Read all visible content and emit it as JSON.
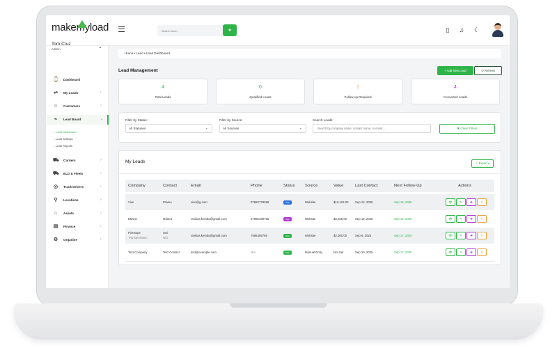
{
  "app": {
    "logo_text": "makemyload",
    "search_placeholder": "Search here...",
    "search_button": "●"
  },
  "user": {
    "name": "Tom Cruz",
    "role": "Admin"
  },
  "sidebar": {
    "items": [
      {
        "label": "Dashboard",
        "icon": "⌚",
        "chev": ""
      },
      {
        "label": "My Loads",
        "icon": "⇌",
        "chev": "›"
      },
      {
        "label": "Customers",
        "icon": "☺",
        "chev": "›"
      },
      {
        "label": "Lead Board",
        "icon": "⌁",
        "chev": "⌄"
      },
      {
        "label": "Carriers",
        "icon": "⛟",
        "chev": "›"
      },
      {
        "label": "ELD & Fleets",
        "icon": "⛟",
        "chev": "›"
      },
      {
        "label": "Track Drivers",
        "icon": "◎",
        "chev": "›"
      },
      {
        "label": "Locations",
        "icon": "⚲",
        "chev": "›"
      },
      {
        "label": "Assets",
        "icon": "⌂",
        "chev": "›"
      },
      {
        "label": "Finance",
        "icon": "▤",
        "chev": "›"
      },
      {
        "label": "Organise",
        "icon": "⚙",
        "chev": "›"
      }
    ],
    "sub_items": [
      "Lead Dashboard",
      "Lead Settings",
      "Lead Reports"
    ]
  },
  "breadcrumb": "Home  •  Lead  •  Lead Dashboard",
  "page_title": "Lead Management",
  "buttons": {
    "add": "+ Add New Lead",
    "refresh": "↻ Refresh",
    "clear": "✖ Clear Filters",
    "export": "⇩ Export ▾"
  },
  "stats": [
    {
      "value": "4",
      "label": "Total Leads",
      "color": "#2fb44a"
    },
    {
      "value": "0",
      "label": "Qualified Leads",
      "color": "#2fb44a"
    },
    {
      "value": "1",
      "label": "Follow-up Required",
      "color": "#f0a23a"
    },
    {
      "value": "4",
      "label": "Converted Leads",
      "color": "#b03bd6"
    }
  ],
  "filters": {
    "status_label": "Filter by Status:",
    "status_value": "All Statuses",
    "source_label": "Filter by Source:",
    "source_value": "All Sources",
    "search_label": "Search Leads:",
    "search_placeholder": "Search by company name, contact name, or email..."
  },
  "leads": {
    "title": "My Leads",
    "columns": [
      "Company",
      "Contact",
      "Email",
      "Phone",
      "Status",
      "Source",
      "Value",
      "Last Contact",
      "Next Follow-Up",
      "Actions"
    ],
    "rows": [
      {
        "company": "Vive",
        "company2": "",
        "contact": "Pramo",
        "contact2": "",
        "email": "vive@g.com",
        "phone": "07892778298",
        "status": "New",
        "status_color": "#2f6fe0",
        "source": "Website",
        "value": "$12,122.00",
        "last_contact": "Sep 12, 2025",
        "next_followup": "Sep 19, 2025"
      },
      {
        "company": "EMCO",
        "company2": "",
        "contact": "Robert",
        "contact2": "",
        "email": "ravikas.kemba@gmail.com",
        "phone": "07986489765",
        "status": "New",
        "status_color": "#b03bd6",
        "source": "Website",
        "value": "$3,465.00",
        "last_contact": "Sep 12, 2025",
        "next_followup": "Sep 19, 2025"
      },
      {
        "company": "Firestope",
        "company2": "Transportation",
        "contact": "ravi",
        "contact2": "N/D",
        "email": "ravikas.kemba@gmail.com",
        "phone": "7986489765",
        "status": "New",
        "status_color": "#2fb44a",
        "source": "Website",
        "value": "$2,000.00",
        "last_contact": "Sep 6, 2025",
        "next_followup": "Sep 17, 2025"
      },
      {
        "company": "Test Company",
        "company2": "",
        "contact": "Test Contact",
        "contact2": "",
        "email": "test@example.com",
        "phone": "N/A",
        "status": "New",
        "status_color": "#2fb44a",
        "source": "Manual Entry",
        "value": "Not Set",
        "last_contact": "Sep 10, 2025",
        "next_followup": "Sep 17, 2025"
      }
    ],
    "actions": [
      {
        "glyph": "👁",
        "color": "#2fb44a"
      },
      {
        "glyph": "✎",
        "color": "#2fb44a"
      },
      {
        "glyph": "✚",
        "color": "#b03bd6"
      },
      {
        "glyph": "✕",
        "color": "#f0a23a"
      }
    ]
  }
}
